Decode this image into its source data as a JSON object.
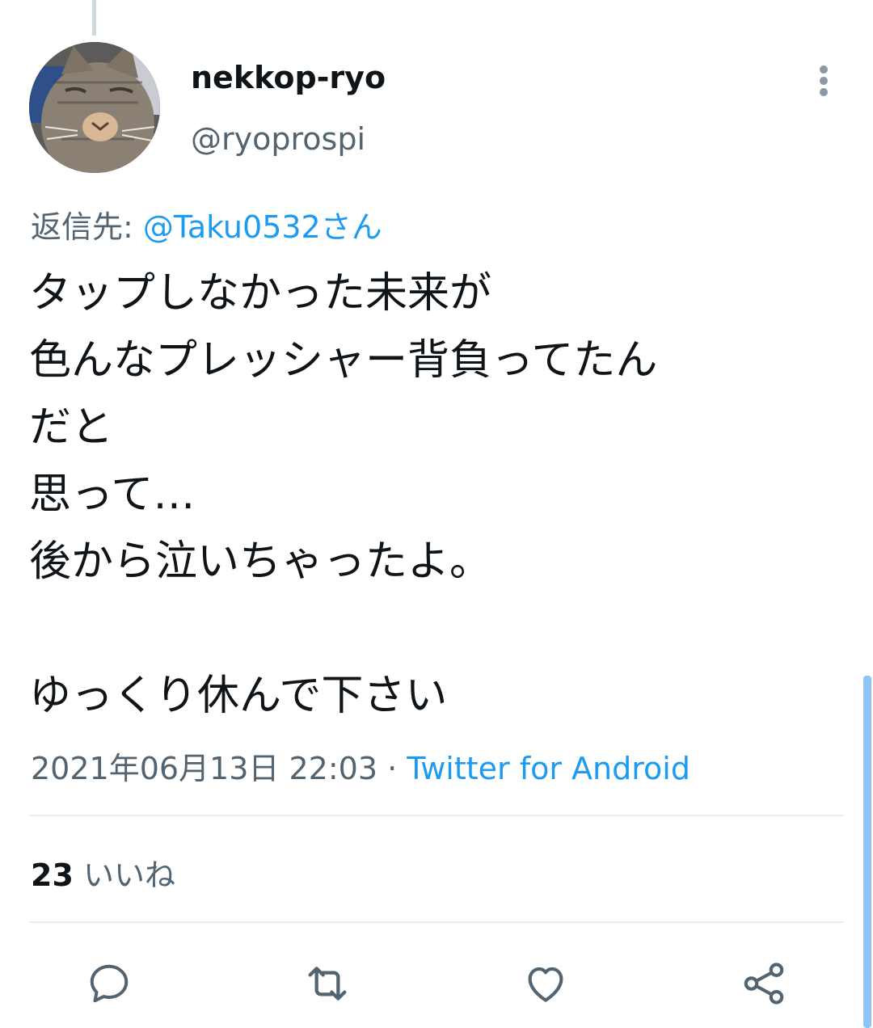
{
  "tweet": {
    "user": {
      "display_name": "nekkop-ryo",
      "handle": "@ryoprospi",
      "avatar_icon": "cat-avatar"
    },
    "reply_to": {
      "prefix": "返信先: ",
      "mention": "@Taku0532さん"
    },
    "text_lines": [
      "タップしなかった未来が",
      "色んなプレッシャー背負ってたん",
      "だと",
      "思って…",
      "後から泣いちゃったよ。",
      "",
      "ゆっくり休んで下さい"
    ],
    "timestamp": "2021年06月13日 22:03",
    "separator": " · ",
    "source": "Twitter for Android",
    "likes": {
      "count": "23",
      "label": " いいね"
    }
  },
  "actions": [
    {
      "icon": "reply-icon"
    },
    {
      "icon": "retweet-icon"
    },
    {
      "icon": "like-icon"
    },
    {
      "icon": "share-icon"
    }
  ],
  "colors": {
    "accent": "#1d9bf0",
    "secondary_text": "#536471",
    "primary_text": "#0f1419",
    "divider": "#e6ecf0"
  }
}
